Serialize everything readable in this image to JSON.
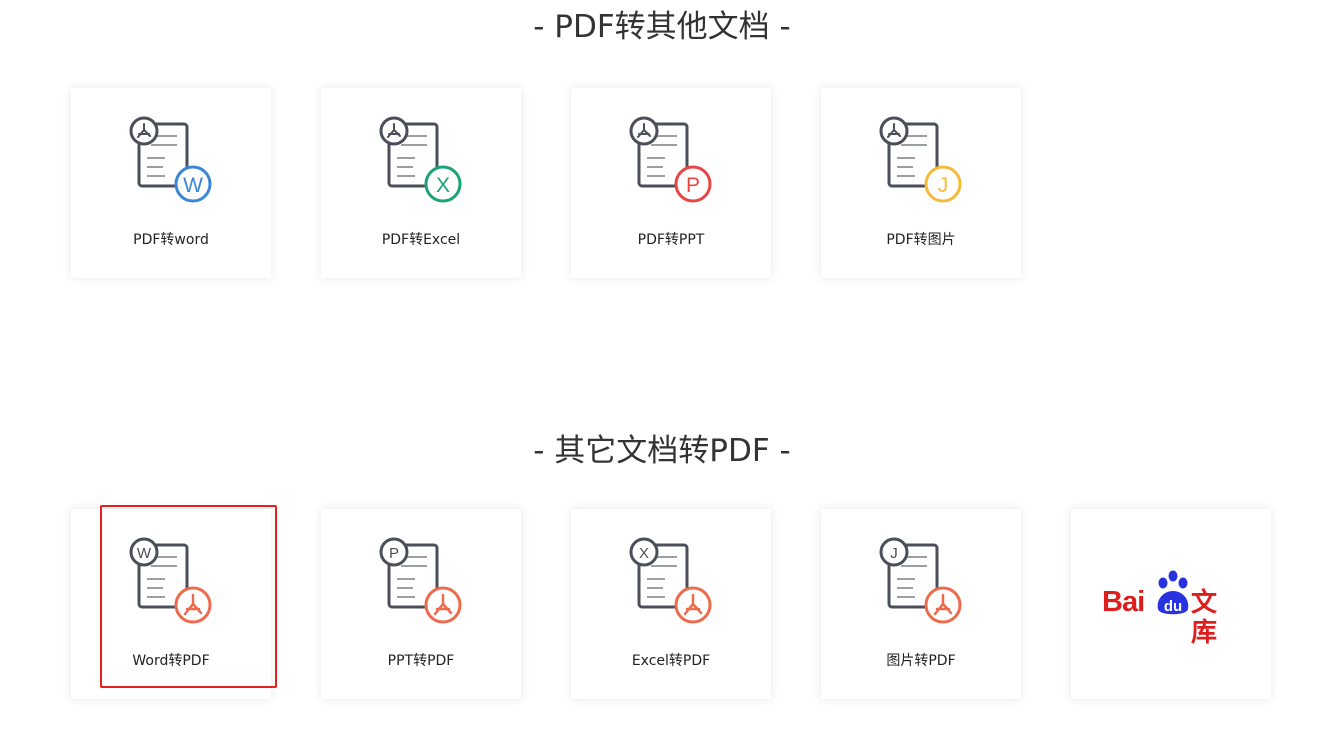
{
  "sections": [
    {
      "title": "- PDF转其他文档 -",
      "cards": [
        {
          "label": "PDF转word",
          "badge_letter": "W",
          "badge_color": "#3a86d9"
        },
        {
          "label": "PDF转Excel",
          "badge_letter": "X",
          "badge_color": "#1aa377"
        },
        {
          "label": "PDF转PPT",
          "badge_letter": "P",
          "badge_color": "#e84545"
        },
        {
          "label": "PDF转图片",
          "badge_letter": "J",
          "badge_color": "#f4bb3b"
        }
      ]
    },
    {
      "title": "- 其它文档转PDF -",
      "cards": [
        {
          "label": "Word转PDF",
          "badge_letter": "W",
          "selected": true
        },
        {
          "label": "PPT转PDF",
          "badge_letter": "P"
        },
        {
          "label": "Excel转PDF",
          "badge_letter": "X"
        },
        {
          "label": "图片转PDF",
          "badge_letter": "J"
        }
      ],
      "extra_card": {
        "logo_text_bai": "Bai",
        "logo_text_du": "du",
        "logo_text_wenku": "文库",
        "logo_color": "#de1d1d",
        "paw_color": "#2932e1"
      }
    }
  ],
  "colors": {
    "pdf_accent": "#ee6a4c",
    "icon_stroke": "#4a4f59",
    "highlight": "#e8201c"
  }
}
